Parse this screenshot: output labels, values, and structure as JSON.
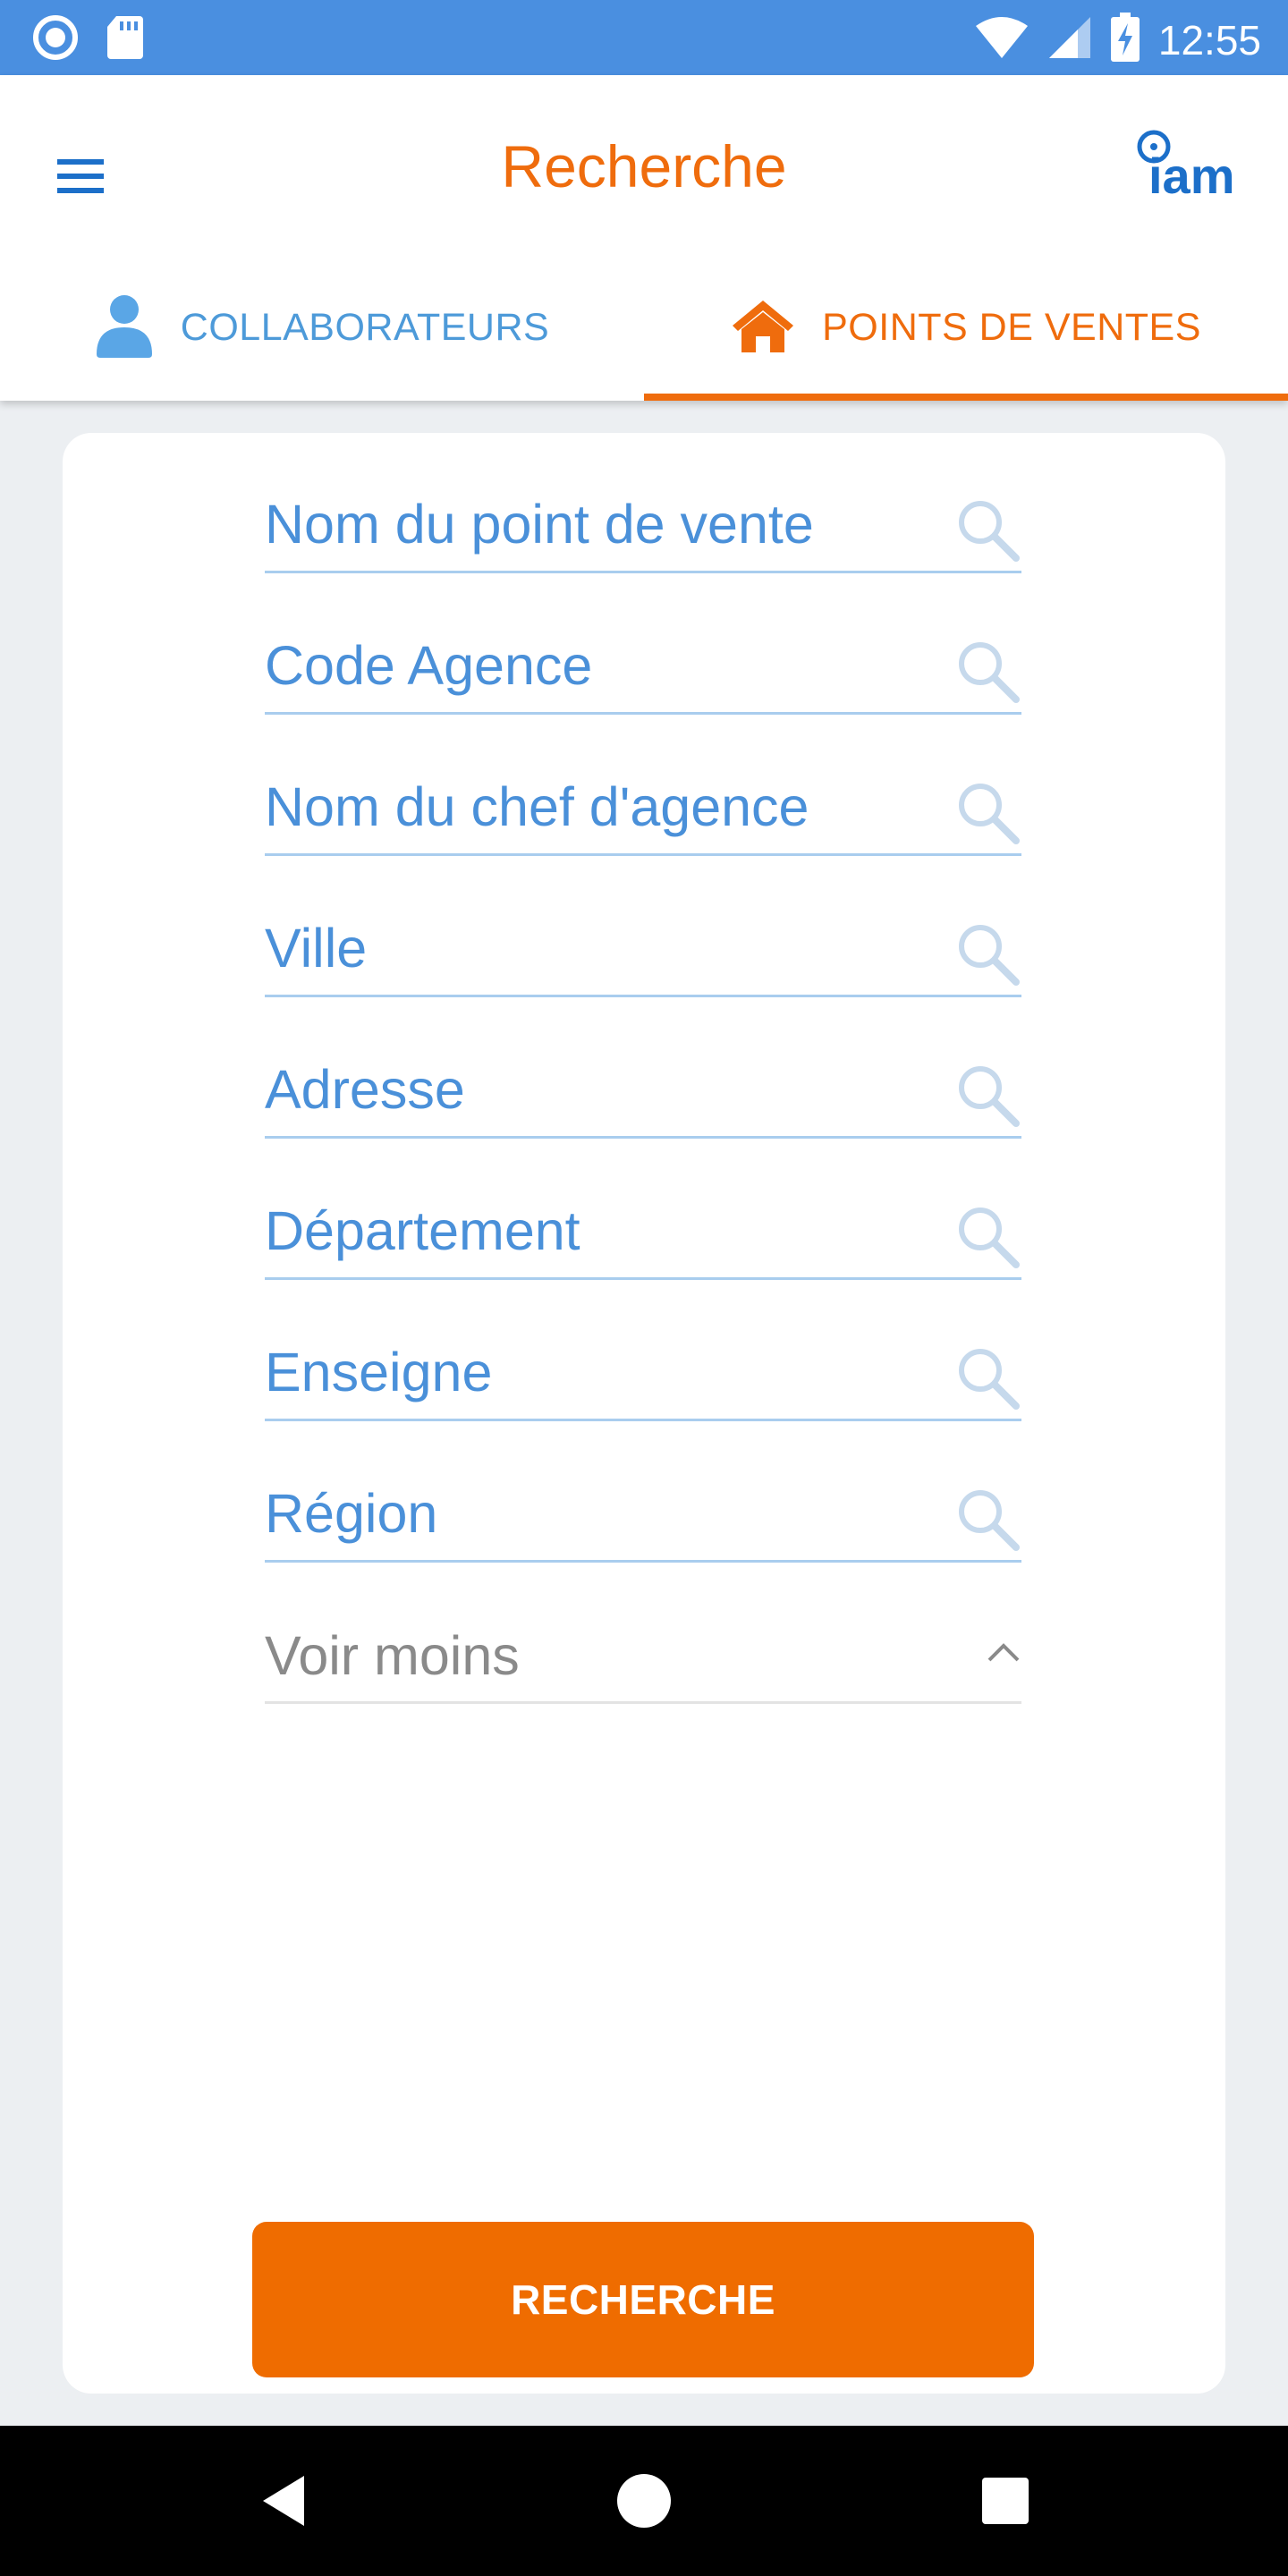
{
  "status_bar": {
    "time": "12:55",
    "icons": [
      "circle-record-icon",
      "sd-card-icon",
      "wifi-icon",
      "signal-icon",
      "battery-charging-icon"
    ]
  },
  "app_bar": {
    "title": "Recherche",
    "menu_icon": "hamburger-menu-icon",
    "logo_text": "iam"
  },
  "tabs": [
    {
      "label": "COLLABORATEURS",
      "icon": "person-icon",
      "selected": false
    },
    {
      "label": "POINTS DE VENTES",
      "icon": "home-icon",
      "selected": true
    }
  ],
  "form": {
    "fields": [
      {
        "placeholder": "Nom du point de vente",
        "value": ""
      },
      {
        "placeholder": "Code Agence",
        "value": ""
      },
      {
        "placeholder": "Nom du chef d'agence",
        "value": ""
      },
      {
        "placeholder": "Ville",
        "value": ""
      },
      {
        "placeholder": "Adresse",
        "value": ""
      },
      {
        "placeholder": "Département",
        "value": ""
      },
      {
        "placeholder": "Enseigne",
        "value": ""
      },
      {
        "placeholder": "Région",
        "value": ""
      }
    ],
    "toggle_label": "Voir moins",
    "submit_label": "RECHERCHE"
  },
  "colors": {
    "accent": "#ef6c0d",
    "status_bar": "#4a8fe0",
    "field_text": "#4a90d9",
    "background": "#eceff2"
  },
  "nav_bar": {
    "buttons": [
      "back-icon",
      "home-circle-icon",
      "recents-icon"
    ]
  }
}
